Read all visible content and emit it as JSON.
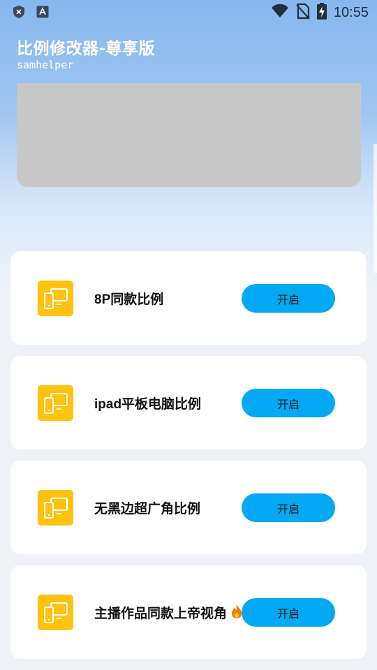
{
  "status_bar": {
    "time": "10:55",
    "left_icons": [
      "shield-icon",
      "text-a-icon"
    ],
    "right_icons": [
      "wifi-icon",
      "no-sim-icon",
      "battery-charging-icon"
    ]
  },
  "header": {
    "title": "比例修改器-尊享版",
    "subtitle": "samhelper"
  },
  "items": [
    {
      "label": "8P同款比例",
      "button": "开启"
    },
    {
      "label": "ipad平板电脑比例",
      "button": "开启"
    },
    {
      "label": "无黑边超广角比例",
      "button": "开启"
    },
    {
      "label": "主播作品同款上帝视角",
      "button": "开启",
      "badge_icon": "fire-icon"
    }
  ],
  "colors": {
    "accent_button": "#03a9f4",
    "icon_bg": "#ffc20e",
    "header_bg": "#86b7ee",
    "banner_placeholder": "#c8c8c8"
  }
}
